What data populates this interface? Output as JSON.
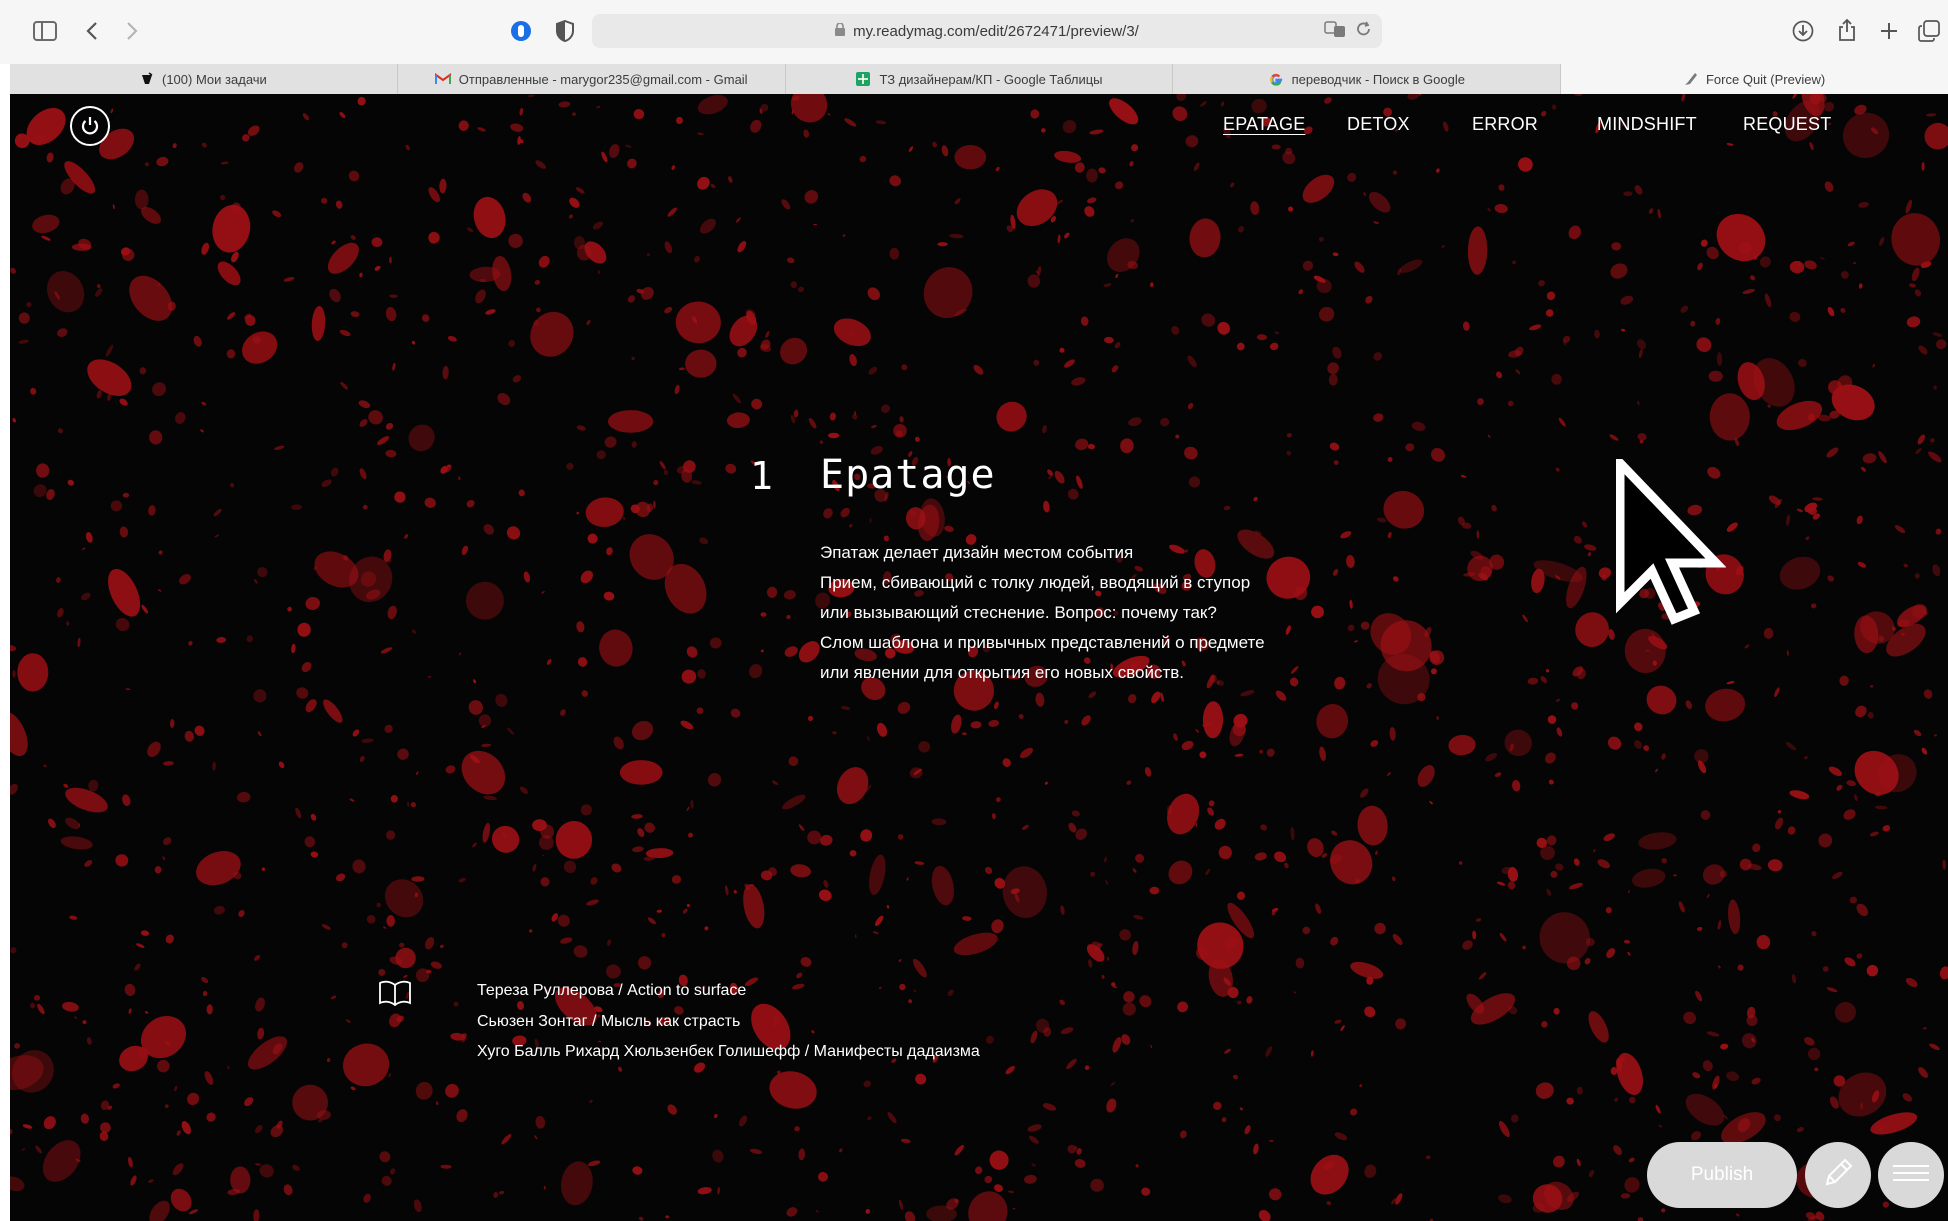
{
  "browser": {
    "url": "my.readymag.com/edit/2672471/preview/3/",
    "tabs": [
      {
        "label": "(100) Мои задачи",
        "icon": "asana-icon",
        "active": false
      },
      {
        "label": "Отправленные - marygor235@gmail.com - Gmail",
        "icon": "gmail-icon",
        "active": false
      },
      {
        "label": "ТЗ дизайнерам/КП - Google Таблицы",
        "icon": "google-sheets-icon",
        "active": false
      },
      {
        "label": "переводчик - Поиск в Google",
        "icon": "google-icon",
        "active": false
      },
      {
        "label": "Force Quit (Preview)",
        "icon": "preview-icon",
        "active": true
      }
    ]
  },
  "nav": {
    "items": [
      "EPATAGE",
      "DETOX",
      "ERROR",
      "MINDSHIFT",
      "REQUEST"
    ],
    "active": "EPATAGE"
  },
  "section": {
    "number": "1",
    "title": "Epatage",
    "description_lines": [
      "Эпатаж делает дизайн местом события",
      "Прием, сбивающий с толку людей, вводящий в ступор",
      "или вызывающий стеснение. Вопрос: почему так?",
      "Слом шаблона и привычных представлений о предмете",
      "или явлении для открытия его новых свойств."
    ]
  },
  "references": [
    "Тереза Руллерова / Action to surface",
    "Сьюзен Зонтаг / Мысль как страсть",
    "Хуго Балль Рихард Хюльзенбек Голишефф / Манифесты дадаизма"
  ],
  "editor": {
    "publish_label": "Publish"
  },
  "colors": {
    "background": "#050505",
    "texture": "#9e1015",
    "text": "#ffffff",
    "button": "#d9d9d9"
  }
}
